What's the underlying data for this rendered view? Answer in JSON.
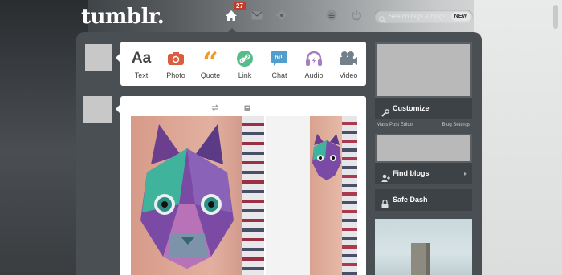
{
  "header": {
    "logo": "tumblr.",
    "notification_count": "27",
    "search": {
      "placeholder": "Search tags & blogs",
      "new_label": "NEW"
    }
  },
  "post_types": [
    {
      "label": "Text",
      "icon": "text-icon",
      "color": "#444444"
    },
    {
      "label": "Photo",
      "icon": "camera-icon",
      "color": "#d95e40"
    },
    {
      "label": "Quote",
      "icon": "quote-icon",
      "color": "#f2992e"
    },
    {
      "label": "Link",
      "icon": "link-icon",
      "color": "#56bc8a"
    },
    {
      "label": "Chat",
      "icon": "chat-icon",
      "color": "#529ecc"
    },
    {
      "label": "Audio",
      "icon": "headphones-icon",
      "color": "#a77dc2"
    },
    {
      "label": "Video",
      "icon": "video-icon",
      "color": "#748089"
    }
  ],
  "sidebar": {
    "customize": "Customize",
    "mass_post_editor": "Mass Post Editor",
    "blog_settings": "Blog Settings",
    "find_blogs": "Find blogs",
    "safe_dash": "Safe Dash"
  }
}
